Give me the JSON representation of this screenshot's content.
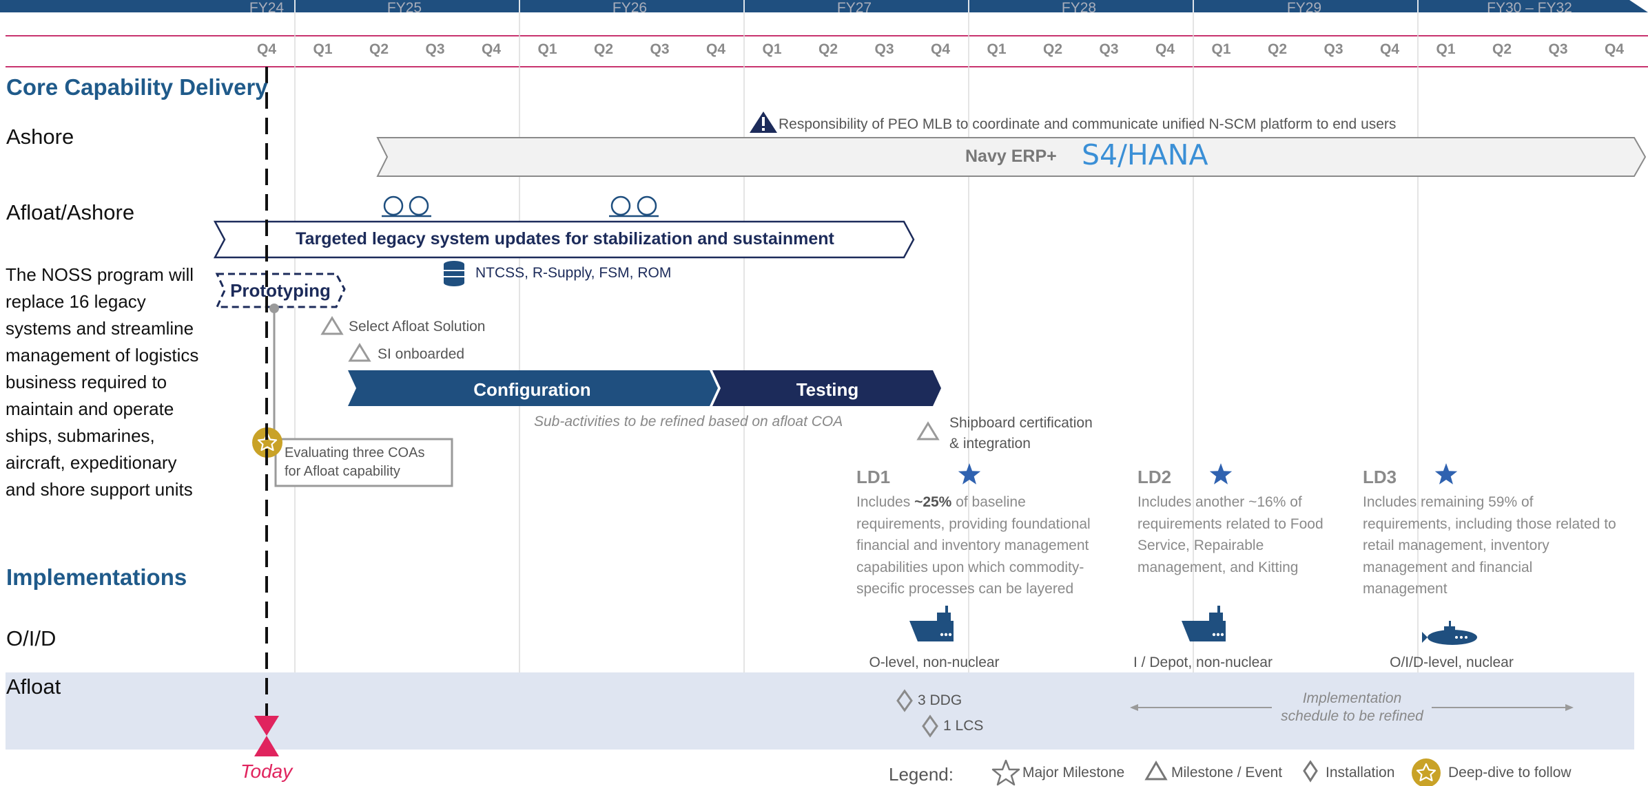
{
  "timeline": {
    "fiscal_years": [
      "FY24",
      "FY25",
      "FY26",
      "FY27",
      "FY28",
      "FY29",
      "FY30 – FY32"
    ],
    "quarters": [
      "Q4",
      "Q1",
      "Q2",
      "Q3",
      "Q4",
      "Q1",
      "Q2",
      "Q3",
      "Q4",
      "Q1",
      "Q2",
      "Q3",
      "Q4",
      "Q1",
      "Q2",
      "Q3",
      "Q4",
      "Q1",
      "Q2",
      "Q3",
      "Q4",
      "Q1",
      "Q2",
      "Q3",
      "Q4"
    ]
  },
  "sections": {
    "core": "Core Capability Delivery",
    "implementations": "Implementations"
  },
  "rows": {
    "ashore": "Ashore",
    "afloat_ashore": "Afloat/Ashore",
    "oid": "O/I/D",
    "afloat": "Afloat"
  },
  "description": "The NOSS program will replace 16 legacy systems and streamline management of logistics business required to maintain and operate ships, submarines, aircraft, expeditionary and shore support units",
  "ashore": {
    "warning_note": "Responsibility of PEO MLB to coordinate and communicate unified N-SCM platform to end users",
    "bar_label": "Navy ERP+",
    "bar_product": "S4/HANA"
  },
  "legacy": {
    "bar_label": "Targeted legacy system updates for stabilization and sustainment",
    "systems_note": "NTCSS, R-Supply, FSM, ROM"
  },
  "prototyping": {
    "label": "Prototyping"
  },
  "milestones": {
    "select_afloat": "Select Afloat Solution",
    "si_onboarded": "SI onboarded",
    "shipboard_line1": "Shipboard certification",
    "shipboard_line2": "& integration"
  },
  "phases": {
    "configuration": "Configuration",
    "testing": "Testing",
    "sub_note": "Sub-activities to be refined based on afloat COA"
  },
  "coa_box": {
    "line1": "Evaluating three COAs",
    "line2": "for Afloat capability"
  },
  "ld": [
    {
      "title": "LD1",
      "desc_pre": "Includes ",
      "desc_bold": "~25%",
      "desc_post": " of baseline requirements, providing foundational financial and inventory management capabilities upon which commodity-specific processes can be layered",
      "impl": "O-level, non-nuclear",
      "vessel_icon": "ship-icon"
    },
    {
      "title": "LD2",
      "desc_pre": "Includes another ~16% of requirements related to Food Service, Repairable management, and Kitting",
      "desc_bold": "",
      "desc_post": "",
      "impl": "I / Depot, non-nuclear",
      "vessel_icon": "ship-icon"
    },
    {
      "title": "LD3",
      "desc_pre": "Includes remaining 59% of requirements, including those related to retail management, inventory management and financial management",
      "desc_bold": "",
      "desc_post": "",
      "impl": "O/I/D-level, nuclear",
      "vessel_icon": "submarine-icon"
    }
  ],
  "installations": {
    "ddg": "3 DDG",
    "lcs": "1 LCS"
  },
  "impl_schedule": {
    "line1": "Implementation",
    "line2": "schedule to be refined"
  },
  "today": "Today",
  "legend": {
    "title": "Legend:",
    "major": "Major Milestone",
    "milestone": "Milestone / Event",
    "installation": "Installation",
    "deepdive": "Deep-dive to follow"
  },
  "colors": {
    "navy": "#1c2b5a",
    "blue": "#1f5a8a",
    "accent_pink": "#e0245e",
    "gold": "#c9a227",
    "star_blue": "#2f62b0",
    "afloat_band": "#dfe5f1",
    "product_blue": "#3a8fd6"
  }
}
